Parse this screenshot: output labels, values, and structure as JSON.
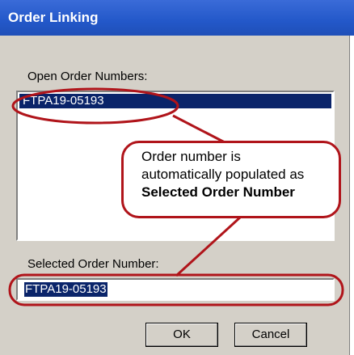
{
  "window": {
    "title": "Order Linking"
  },
  "open_orders": {
    "label": "Open Order Numbers:",
    "items": [
      "FTPA19-05193"
    ]
  },
  "selected_order": {
    "label": "Selected Order Number:",
    "value": "FTPA19-05193"
  },
  "buttons": {
    "ok": "OK",
    "cancel": "Cancel"
  },
  "callout": {
    "line1": "Order number is",
    "line2": "automatically populated as",
    "line3": "Selected Order Number"
  },
  "colors": {
    "annotation": "#b0141a",
    "selection": "#0a246a",
    "titlebar": "#2358c9"
  }
}
